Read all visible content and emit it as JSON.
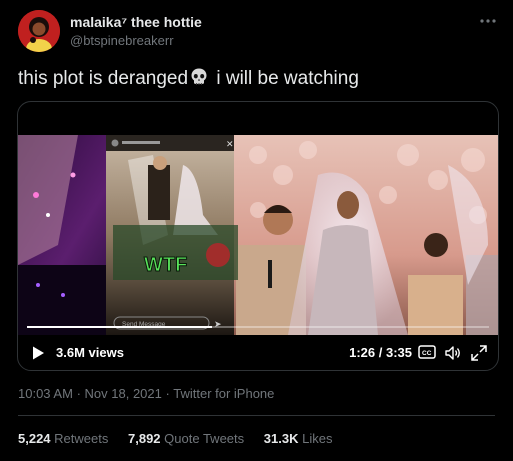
{
  "user": {
    "display_name": "malaika⁷ thee hottie",
    "handle": "@btspinebreakerr"
  },
  "tweet": {
    "text_before": "this plot is deranged",
    "text_after": " i will be watching",
    "emoji": "skull-icon"
  },
  "video": {
    "views": "3.6M views",
    "time": "1:26 / 3:35",
    "progress": 0.4,
    "overlay_caption": "WTF",
    "story_input_placeholder": "Send Message"
  },
  "meta": {
    "time": "10:03 AM",
    "date": "Nov 18, 2021",
    "source": "Twitter for iPhone",
    "separator": "·"
  },
  "stats": {
    "retweets_count": "5,224",
    "retweets_label": "Retweets",
    "quotes_count": "7,892",
    "quotes_label": "Quote Tweets",
    "likes_count": "31.3K",
    "likes_label": "Likes"
  },
  "colors": {
    "background": "#000000",
    "text_primary": "#e7e9ea",
    "text_secondary": "#71767b",
    "border": "#2f3336"
  }
}
